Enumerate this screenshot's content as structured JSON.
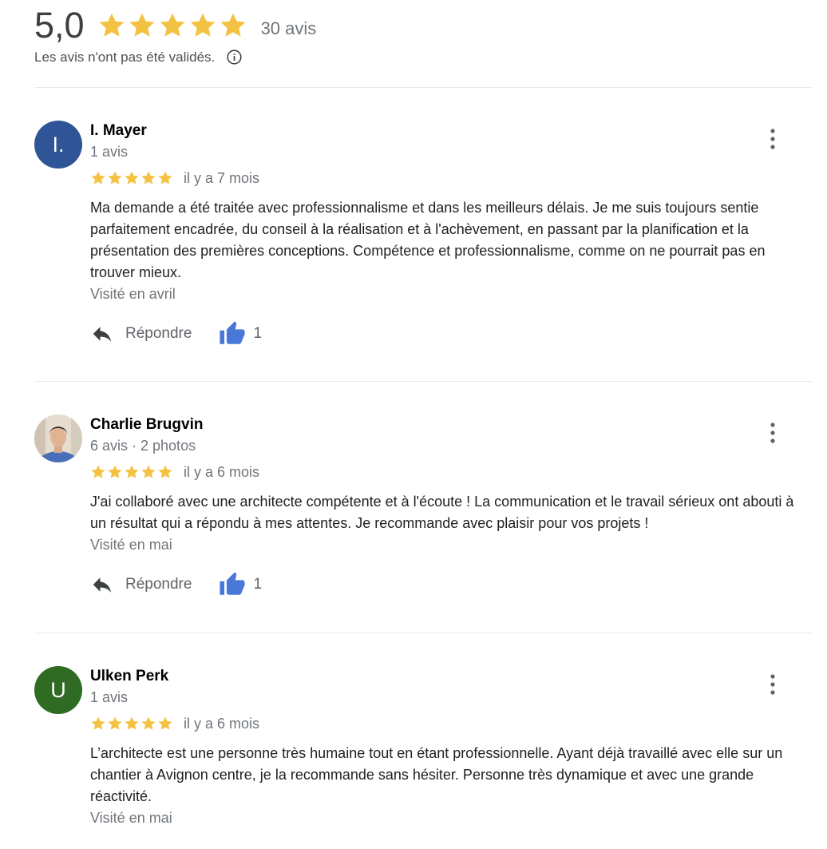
{
  "summary": {
    "rating": "5,0",
    "stars": 5,
    "total_reviews": "30 avis",
    "disclaimer": "Les avis n'ont pas été validés.",
    "star_color": "#f4c243"
  },
  "actions": {
    "reply_label": "Répondre"
  },
  "reviews": [
    {
      "name": "I. Mayer",
      "avatar_letter": "I.",
      "avatar_color": "#2f5597",
      "meta": "1 avis",
      "stars": 5,
      "time": "il y a 7 mois",
      "text": "Ma demande a été traitée avec professionnalisme et dans les meilleurs délais. Je me suis toujours sentie parfaitement encadrée, du conseil à la réalisation et à l'achèvement, en passant par la planification et la présentation des premières conceptions. Compétence et professionnalisme, comme on ne pourrait pas en trouver mieux.",
      "visited": "Visité en avril",
      "likes": "1"
    },
    {
      "name": "Charlie Brugvin",
      "avatar_letter": "",
      "avatar_color": "#d8c9b0",
      "meta": "6 avis · 2 photos",
      "stars": 5,
      "time": "il y a 6 mois",
      "text": "J'ai collaboré avec une architecte compétente et à l'écoute ! La communication et le travail sérieux ont abouti à un résultat qui a répondu à mes attentes. Je recommande avec plaisir pour vos projets !",
      "visited": "Visité en mai",
      "likes": "1"
    },
    {
      "name": "Ulken Perk",
      "avatar_letter": "U",
      "avatar_color": "#2f6b22",
      "meta": "1 avis",
      "stars": 5,
      "time": "il y a 6 mois",
      "text": "L’architecte est une personne très humaine tout en étant professionnelle. Ayant déjà travaillé avec elle sur un chantier à Avignon centre, je la recommande sans hésiter. Personne très dynamique et avec une grande réactivité.",
      "visited": "Visité en mai"
    }
  ]
}
